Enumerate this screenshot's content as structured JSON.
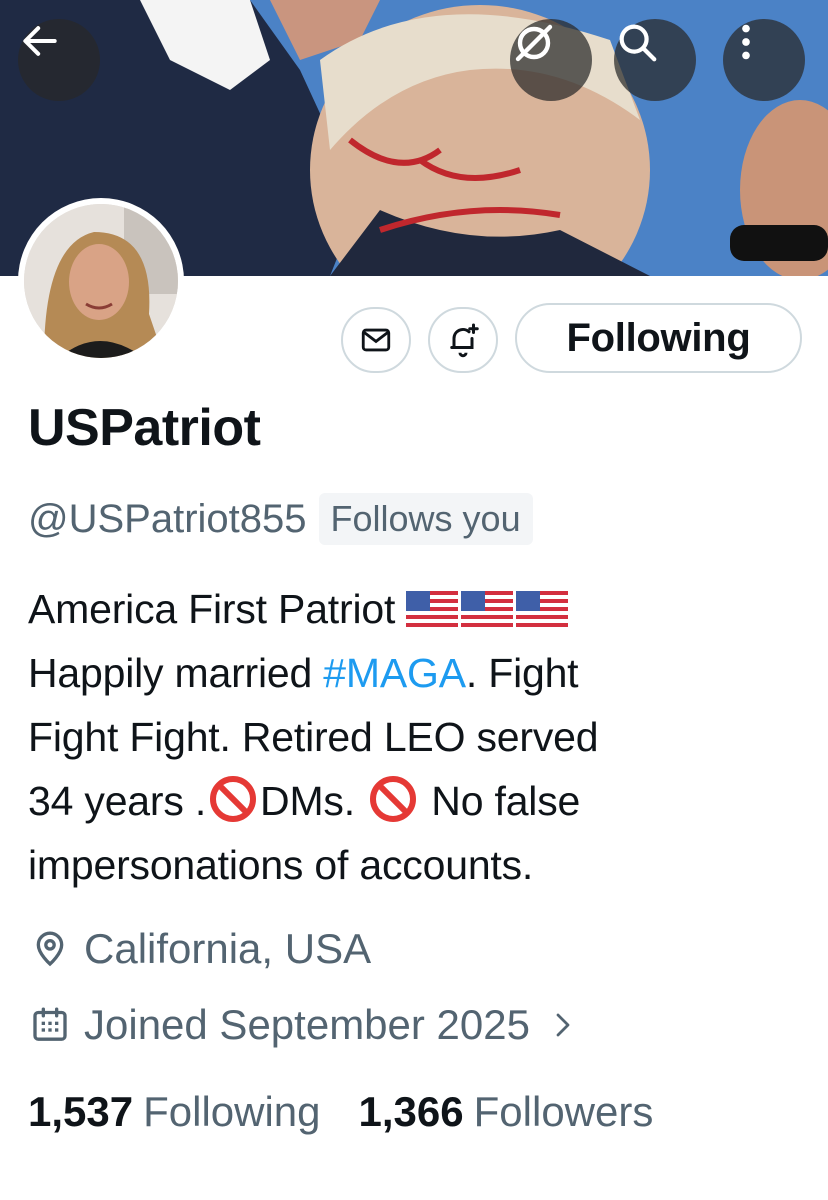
{
  "colors": {
    "accent": "#1d9bf0",
    "muted": "#536471",
    "text": "#0f1419",
    "border": "#cfd9de"
  },
  "header": {
    "icons": [
      "arrow-left-icon",
      "grok-icon",
      "search-icon",
      "more-vertical-icon"
    ]
  },
  "actions": {
    "message_icon": "envelope-icon",
    "notify_icon": "bell-plus-icon",
    "follow_label": "Following"
  },
  "profile": {
    "display_name": "USPatriot",
    "handle": "@USPatriot855",
    "follows_you_badge": "Follows you",
    "bio": {
      "line1_text": "America First Patriot ",
      "line1_emoji": "🇺🇸🇺🇸🇺🇸",
      "line2_pre": "Happily married ",
      "line2_hashtag": "#MAGA",
      "line2_post": ". Fight",
      "line3": "Fight Fight. Retired LEO served",
      "line4_a": "34 years .",
      "line4_emoji1": "🚫",
      "line4_b": "DMs.",
      "line4_emoji2": "🚫",
      "line4_c": " No false",
      "line5": "impersonations of accounts."
    },
    "location": "California, USA",
    "joined": "Joined September 2025",
    "stats": {
      "following_count": "1,537",
      "following_label": "Following",
      "followers_count": "1,366",
      "followers_label": "Followers"
    }
  }
}
